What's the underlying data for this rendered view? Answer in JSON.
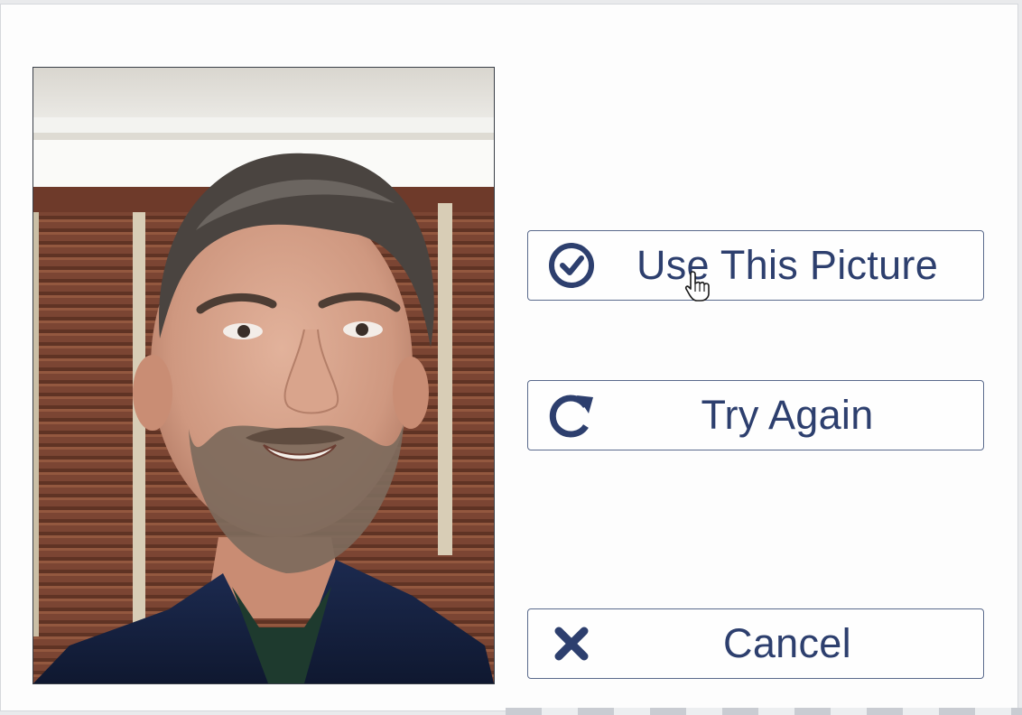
{
  "dialog": {
    "photo": {
      "alt": "Captured webcam picture"
    },
    "buttons": {
      "use_label": "Use This Picture",
      "use_icon": "check-circle-icon",
      "retry_label": "Try Again",
      "retry_icon": "refresh-icon",
      "cancel_label": "Cancel",
      "cancel_icon": "close-icon"
    },
    "colors": {
      "accent": "#2d3f6e",
      "border": "#5a6a8c",
      "background": "#fdfdfd"
    }
  }
}
